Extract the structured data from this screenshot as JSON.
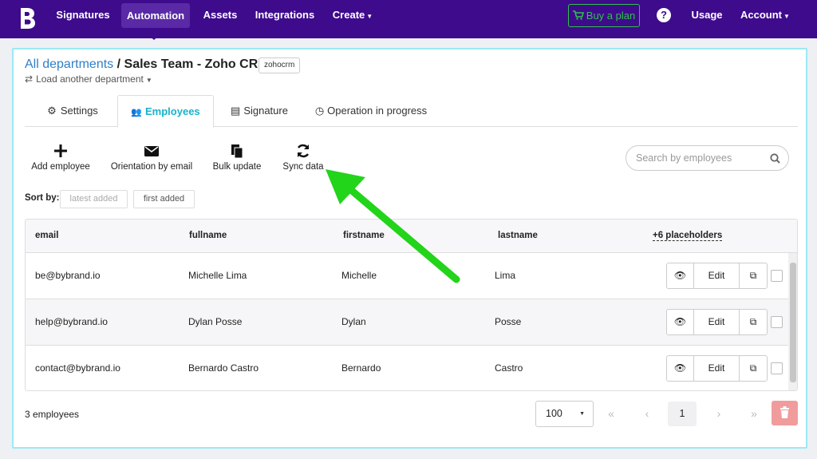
{
  "nav": {
    "items": [
      "Signatures",
      "Automation",
      "Assets",
      "Integrations",
      "Create"
    ],
    "buy_plan": "Buy a plan",
    "usage": "Usage",
    "account": "Account"
  },
  "header": {
    "breadcrumb_link": "All departments",
    "breadcrumb_current": "/ Sales Team - Zoho CRM",
    "tag": "zohocrm",
    "load_another": "Load another department"
  },
  "tabs": [
    "Settings",
    "Employees",
    "Signature",
    "Operation in progress"
  ],
  "tools": [
    "Add employee",
    "Orientation by email",
    "Bulk update",
    "Sync data"
  ],
  "search": {
    "placeholder": "Search by employees"
  },
  "sort": {
    "label": "Sort by:",
    "options": [
      "latest added",
      "first added"
    ]
  },
  "table": {
    "columns": [
      "email",
      "fullname",
      "firstname",
      "lastname",
      "+6 placeholders"
    ],
    "rows": [
      {
        "email": "be@bybrand.io",
        "fullname": "Michelle Lima",
        "firstname": "Michelle",
        "lastname": "Lima"
      },
      {
        "email": "help@bybrand.io",
        "fullname": "Dylan Posse",
        "firstname": "Dylan",
        "lastname": "Posse"
      },
      {
        "email": "contact@bybrand.io",
        "fullname": "Bernardo Castro",
        "firstname": "Bernardo",
        "lastname": "Castro"
      }
    ],
    "edit_label": "Edit"
  },
  "footer": {
    "count": "3 employees",
    "per_page": "100",
    "current_page": "1"
  },
  "colors": {
    "brand": "#3e0b8c",
    "accent": "#17b3c9",
    "link": "#2f7fc8",
    "arrow": "#22d41a"
  }
}
